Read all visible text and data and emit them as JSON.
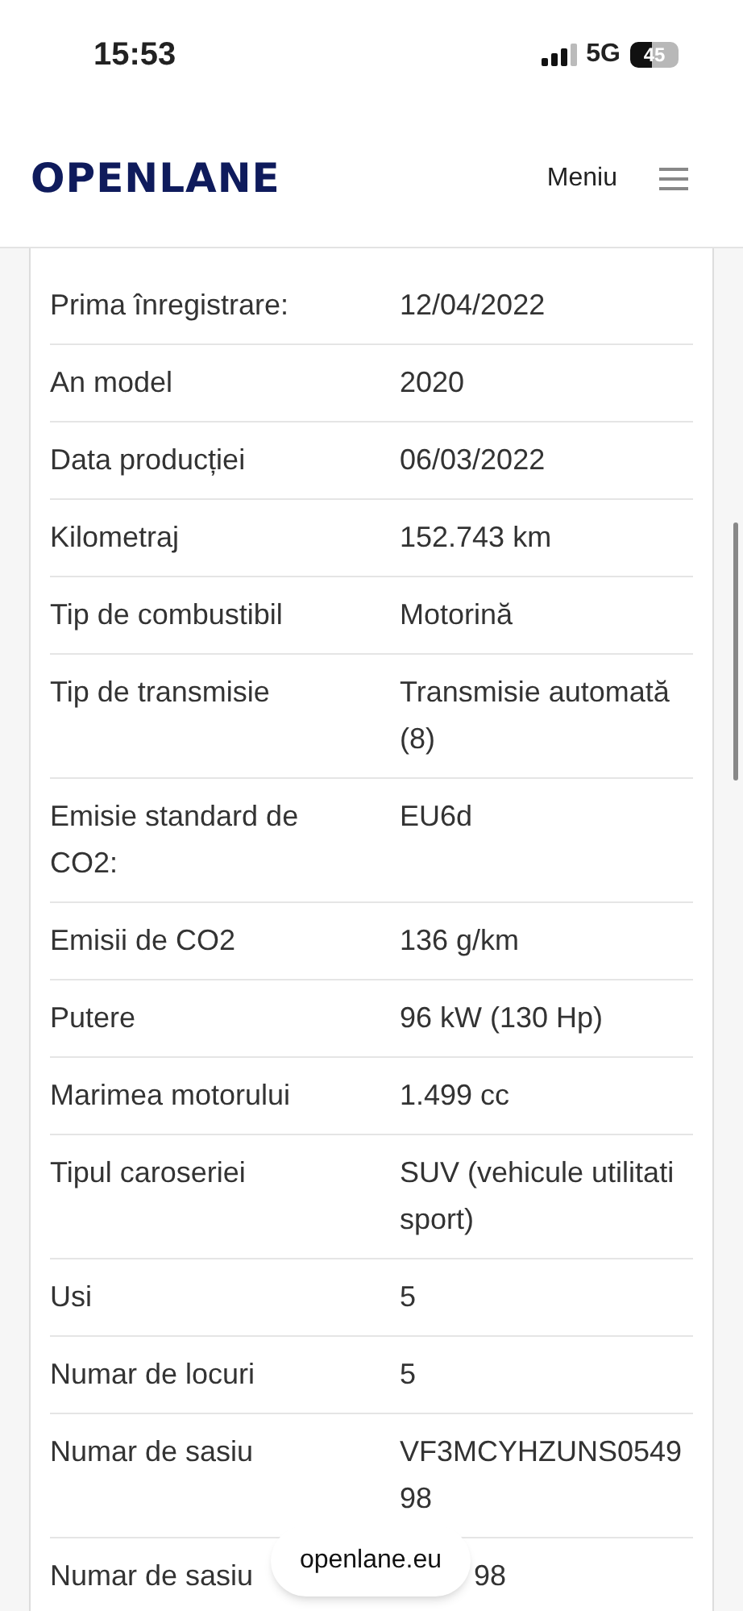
{
  "status_bar": {
    "time": "15:53",
    "network": "5G",
    "battery": "45"
  },
  "header": {
    "logo": "OPENLANE",
    "menu_label": "Meniu"
  },
  "rows": [
    {
      "label": "Prima înregistrare:",
      "value": "12/04/2022"
    },
    {
      "label": "An model",
      "value": "2020"
    },
    {
      "label": "Data producției",
      "value": "06/03/2022"
    },
    {
      "label": "Kilometraj",
      "value": "152.743 km"
    },
    {
      "label": "Tip de combustibil",
      "value": "Motorină"
    },
    {
      "label": "Tip de transmisie",
      "value": "Transmisie automată (8)"
    },
    {
      "label": "Emisie standard de CO2:",
      "value": "EU6d"
    },
    {
      "label": "Emisii de CO2",
      "value": "136 g/km"
    },
    {
      "label": "Putere",
      "value": "96 kW (130 Hp)"
    },
    {
      "label": "Marimea motorului",
      "value": "1.499 cc"
    },
    {
      "label": "Tipul caroseriei",
      "value": "SUV (vehicule utilitati sport)"
    },
    {
      "label": "Usi",
      "value": "5"
    },
    {
      "label": "Numar de locuri",
      "value": "5"
    },
    {
      "label": "Numar de sasiu",
      "value": "VF3MCYHZUNS0549 98"
    },
    {
      "label": "Numar de sasiu",
      "value": "98",
      "kind": "covered"
    }
  ],
  "url_pill": "openlane.eu"
}
